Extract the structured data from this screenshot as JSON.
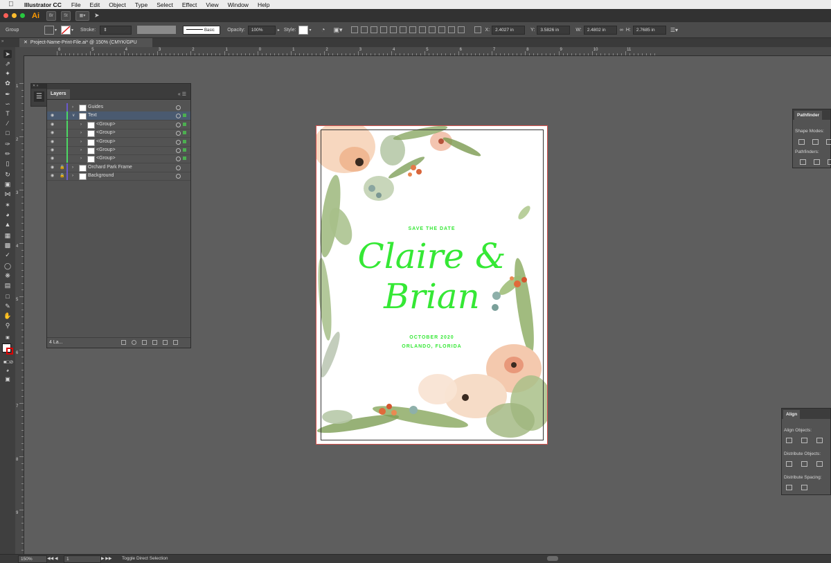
{
  "menubar": {
    "app_name": "Illustrator CC",
    "items": [
      "File",
      "Edit",
      "Object",
      "Type",
      "Select",
      "Effect",
      "View",
      "Window",
      "Help"
    ]
  },
  "appbar": {
    "logo": "Ai",
    "buttons": [
      "Br",
      "St",
      "layout-icon",
      "send-icon"
    ]
  },
  "control": {
    "selection_label": "Group",
    "stroke_label": "Stroke:",
    "brush_label": "Basic",
    "opacity_label": "Opacity:",
    "opacity_value": "100%",
    "style_label": "Style:",
    "x_label": "X:",
    "x_value": "2.4027 in",
    "y_label": "Y:",
    "y_value": "3.5826 in",
    "w_label": "W:",
    "w_value": "2.4802 in",
    "h_label": "H:",
    "h_value": "2.7685 in"
  },
  "document_tab": {
    "title": "Project-Name-Print-File.ai* @ 150% (CMYK/GPU Preview)"
  },
  "ruler": {
    "h_numbers": [
      "6",
      "5",
      "4",
      "3",
      "2",
      "1",
      "0",
      "1",
      "2",
      "3",
      "4",
      "5",
      "6",
      "7",
      "8",
      "9",
      "10",
      "11"
    ],
    "v_numbers": [
      "1",
      "2",
      "3",
      "4",
      "5",
      "6",
      "7",
      "8",
      "9"
    ]
  },
  "layers_panel": {
    "tab_label": "Layers",
    "rows": [
      {
        "name": "Guides",
        "locked": false,
        "visible": false,
        "bar_color": "#6a5acd",
        "depth": 0,
        "expanded": false
      },
      {
        "name": "Text",
        "locked": false,
        "visible": true,
        "bar_color": "#4cd964",
        "depth": 0,
        "expanded": true,
        "selected": true
      },
      {
        "name": "<Group>",
        "locked": false,
        "visible": true,
        "bar_color": "#4cd964",
        "depth": 1
      },
      {
        "name": "<Group>",
        "locked": false,
        "visible": true,
        "bar_color": "#4cd964",
        "depth": 1
      },
      {
        "name": "<Group>",
        "locked": false,
        "visible": true,
        "bar_color": "#4cd964",
        "depth": 1
      },
      {
        "name": "<Group>",
        "locked": false,
        "visible": true,
        "bar_color": "#4cd964",
        "depth": 1
      },
      {
        "name": "<Group>",
        "locked": false,
        "visible": true,
        "bar_color": "#4cd964",
        "depth": 1
      },
      {
        "name": "Orchard Park Frame",
        "locked": true,
        "visible": true,
        "bar_color": "#6a5acd",
        "depth": 0
      },
      {
        "name": "Background",
        "locked": true,
        "visible": true,
        "bar_color": "#6a5acd",
        "depth": 0
      }
    ],
    "footer_count": "4 La..."
  },
  "pathfinder_panel": {
    "tab_label": "Pathfinder",
    "shape_modes_label": "Shape Modes:",
    "pathfinders_label": "Pathfinders:"
  },
  "align_panel": {
    "tab_label": "Align",
    "align_objects_label": "Align Objects:",
    "distribute_objects_label": "Distribute Objects:",
    "distribute_spacing_label": "Distribute Spacing:"
  },
  "artboard": {
    "top_line": "SAVE THE DATE",
    "name_line_1": "Claire &",
    "name_line_2": "Brian",
    "date_line": "OCTOBER 2020",
    "location_line": "ORLANDO, FLORIDA",
    "text_color": "#35e835"
  },
  "statusbar": {
    "zoom": "150%",
    "artboard_number": "1",
    "status_text": "Toggle Direct Selection"
  }
}
